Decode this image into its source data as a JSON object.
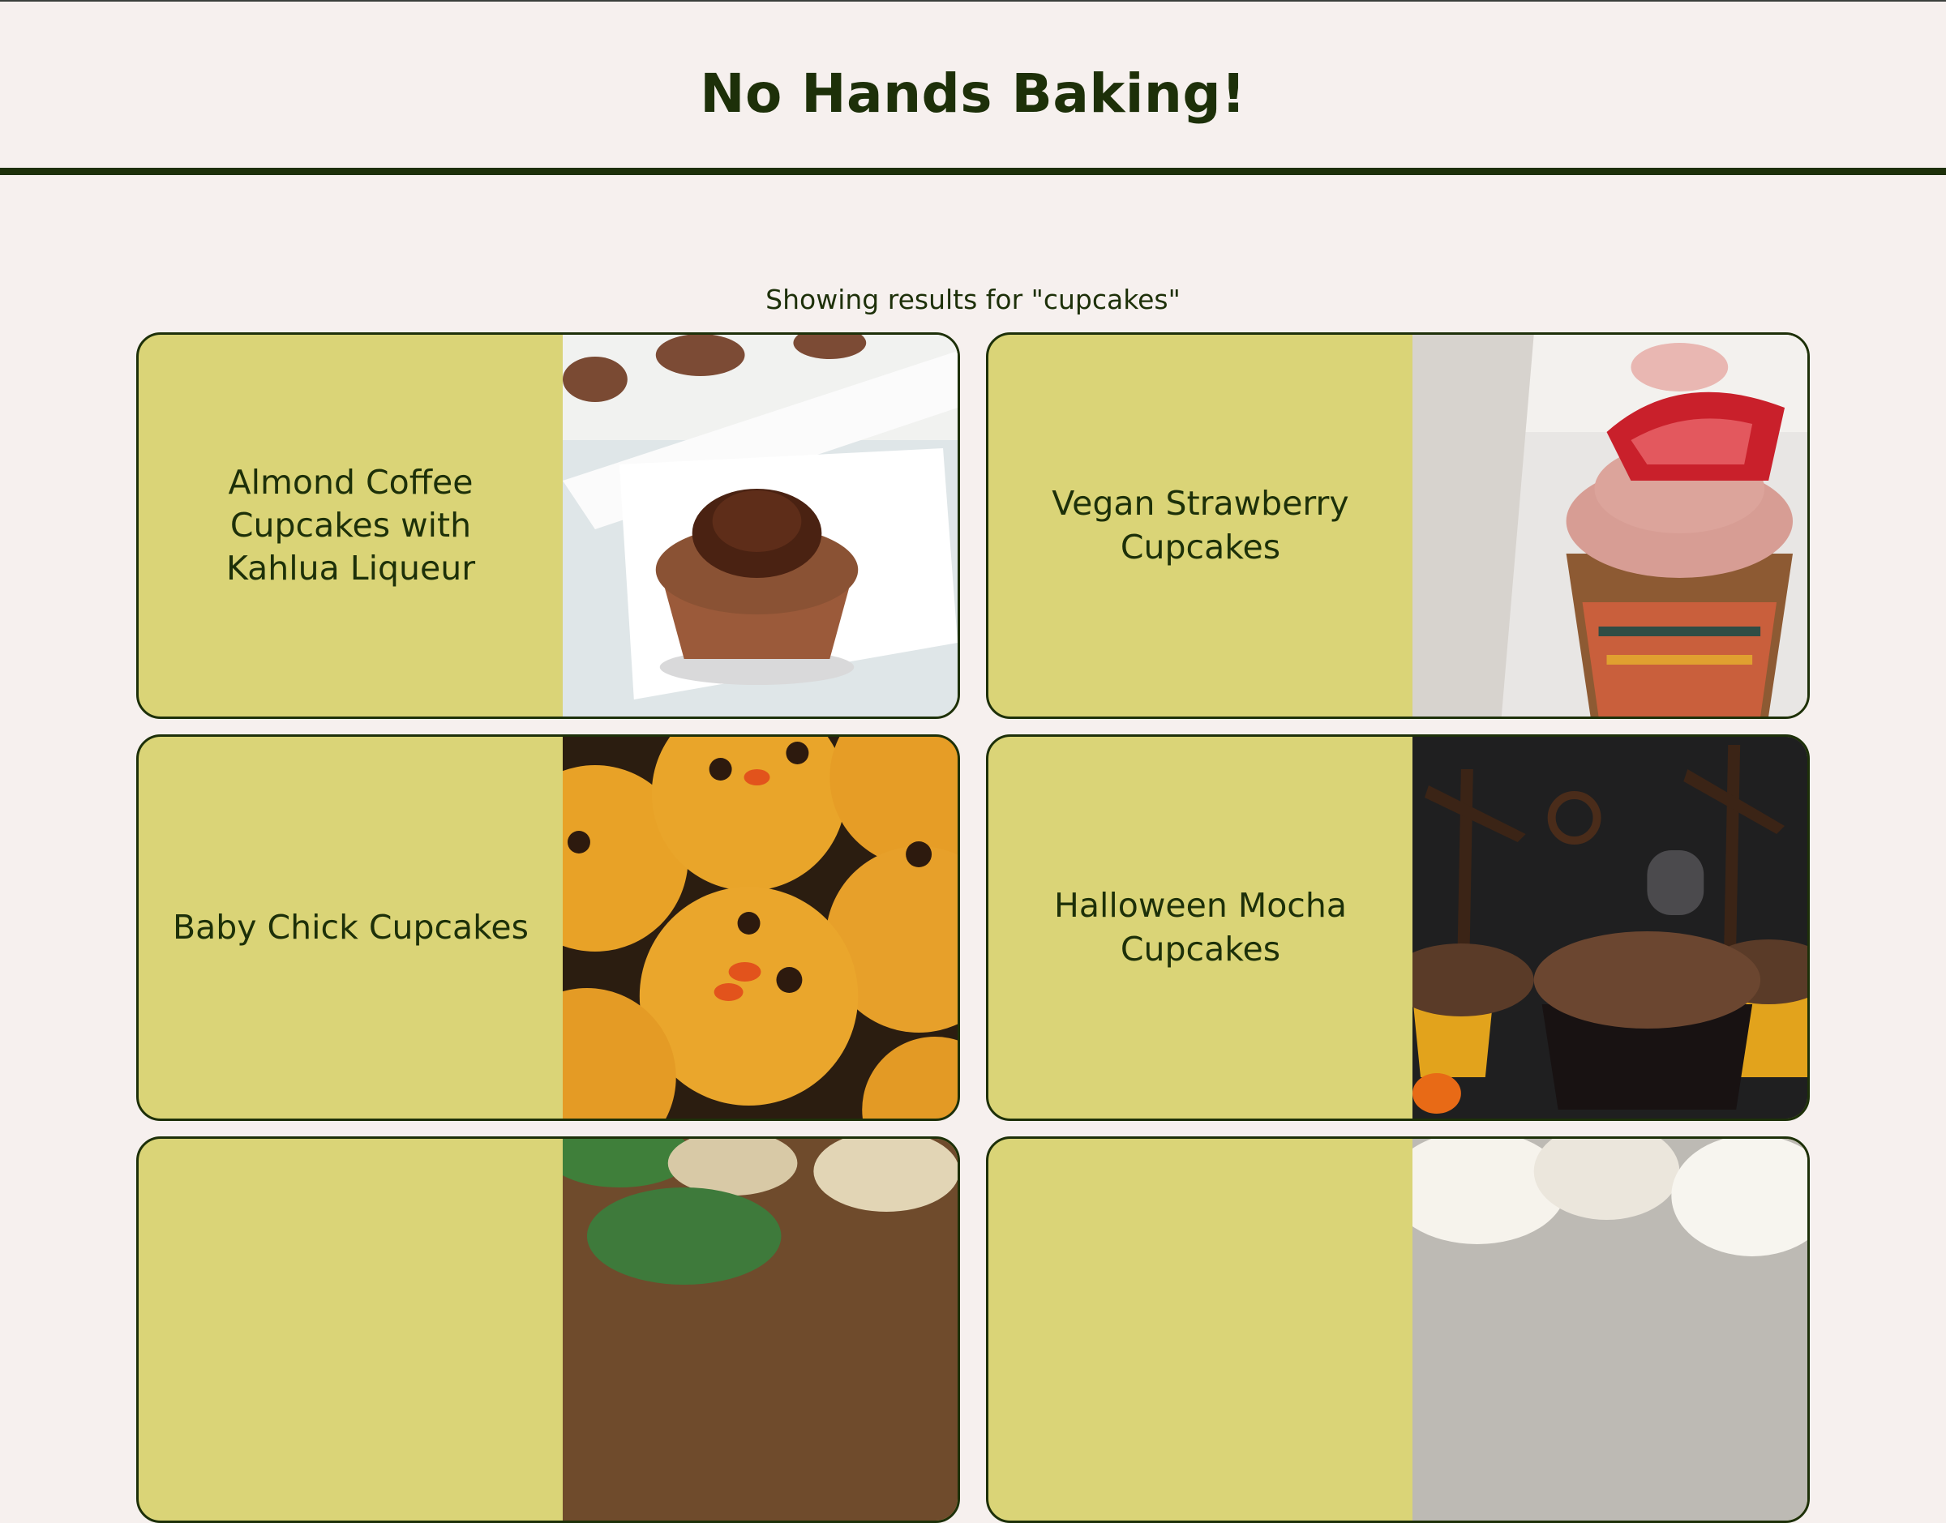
{
  "header": {
    "title": "No Hands Baking!"
  },
  "search": {
    "caption": "Showing results for \"cupcakes\""
  },
  "recipes": [
    {
      "title": "Almond Coffee Cupcakes with Kahlua Liqueur",
      "image": "chocolate-frosted-cupcake-photo"
    },
    {
      "title": "Vegan Strawberry Cupcakes",
      "image": "strawberry-topped-cupcake-photo"
    },
    {
      "title": "Baby Chick Cupcakes",
      "image": "baby-chick-cupcakes-photo"
    },
    {
      "title": "Halloween Mocha Cupcakes",
      "image": "halloween-cupcakes-photo"
    },
    {
      "title": "",
      "image": "cupcake-liners-photo"
    },
    {
      "title": "",
      "image": "coconut-cupcakes-photo"
    }
  ],
  "colors": {
    "background": "#f6f0ee",
    "text": "#1d3009",
    "card": "#dad477"
  }
}
